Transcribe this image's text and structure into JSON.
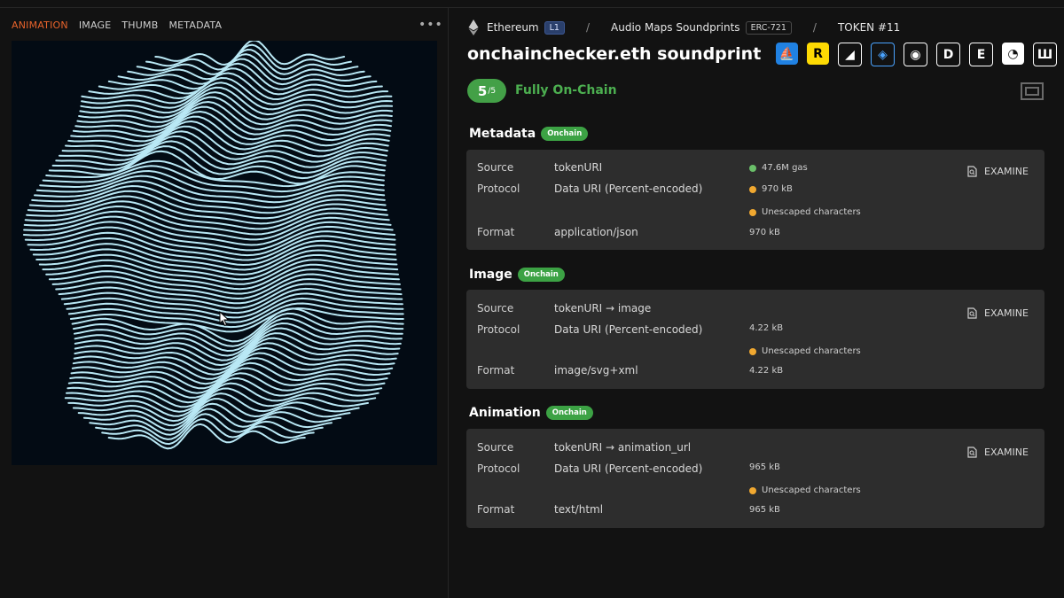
{
  "tabs": [
    "ANIMATION",
    "IMAGE",
    "THUMB",
    "METADATA"
  ],
  "more_label": "•••",
  "breadcrumb": {
    "chain": "Ethereum",
    "layer": "L1",
    "sep": "/",
    "collection": "Audio Maps Soundprints",
    "standard": "ERC-721",
    "token": "TOKEN #11"
  },
  "title": "onchainchecker.eth soundprint",
  "marketplace_icons": [
    {
      "name": "opensea-icon",
      "glyph": "⛵",
      "bg": "#2081e2",
      "fg": "#ffffff"
    },
    {
      "name": "rarible-icon",
      "glyph": "R",
      "bg": "#feda03",
      "fg": "#000000"
    },
    {
      "name": "looksrare-icon",
      "glyph": "◢",
      "bg": "#121212",
      "fg": "#ffffff"
    },
    {
      "name": "blur-icon",
      "glyph": "◈",
      "bg": "#121212",
      "fg": "#4aa3ff"
    },
    {
      "name": "zora-icon",
      "glyph": "◉",
      "bg": "#121212",
      "fg": "#ffffff"
    },
    {
      "name": "d-icon",
      "glyph": "D",
      "bg": "#121212",
      "fg": "#ffffff"
    },
    {
      "name": "etherscan-e-icon",
      "glyph": "E",
      "bg": "#121212",
      "fg": "#ffffff"
    },
    {
      "name": "etherscan-icon",
      "glyph": "◔",
      "bg": "#ffffff",
      "fg": "#121212"
    },
    {
      "name": "m-icon",
      "glyph": "Ш",
      "bg": "#121212",
      "fg": "#ffffff"
    }
  ],
  "score": {
    "value": "5",
    "total": "/5",
    "label": "Fully On-Chain"
  },
  "sections": [
    {
      "title": "Metadata",
      "badge": "Onchain",
      "source": "tokenURI",
      "protocol": "Data URI (Percent-encoded)",
      "format": "application/json",
      "stats": [
        {
          "text": "47.6M gas",
          "color": "green"
        },
        {
          "text": "970 kB",
          "color": "orange"
        },
        {
          "text": "Unescaped characters",
          "color": "orange"
        }
      ],
      "format_size": "970 kB"
    },
    {
      "title": "Image",
      "badge": "Onchain",
      "source": "tokenURI → image",
      "protocol": "Data URI (Percent-encoded)",
      "format": "image/svg+xml",
      "stats": [
        {
          "text": "4.22 kB",
          "color": ""
        },
        {
          "text": "Unescaped characters",
          "color": "orange"
        }
      ],
      "format_size": "4.22 kB"
    },
    {
      "title": "Animation",
      "badge": "Onchain",
      "source": "tokenURI → animation_url",
      "protocol": "Data URI (Percent-encoded)",
      "format": "text/html",
      "stats": [
        {
          "text": "965 kB",
          "color": ""
        },
        {
          "text": "Unescaped characters",
          "color": "orange"
        }
      ],
      "format_size": "965 kB"
    }
  ],
  "labels": {
    "source": "Source",
    "protocol": "Protocol",
    "format": "Format",
    "examine": "EXAMINE"
  },
  "colors": {
    "accent": "#e8632b",
    "onchain_green": "#43a047",
    "wave": "#b9e8f5",
    "art_bg": "#030b14"
  }
}
